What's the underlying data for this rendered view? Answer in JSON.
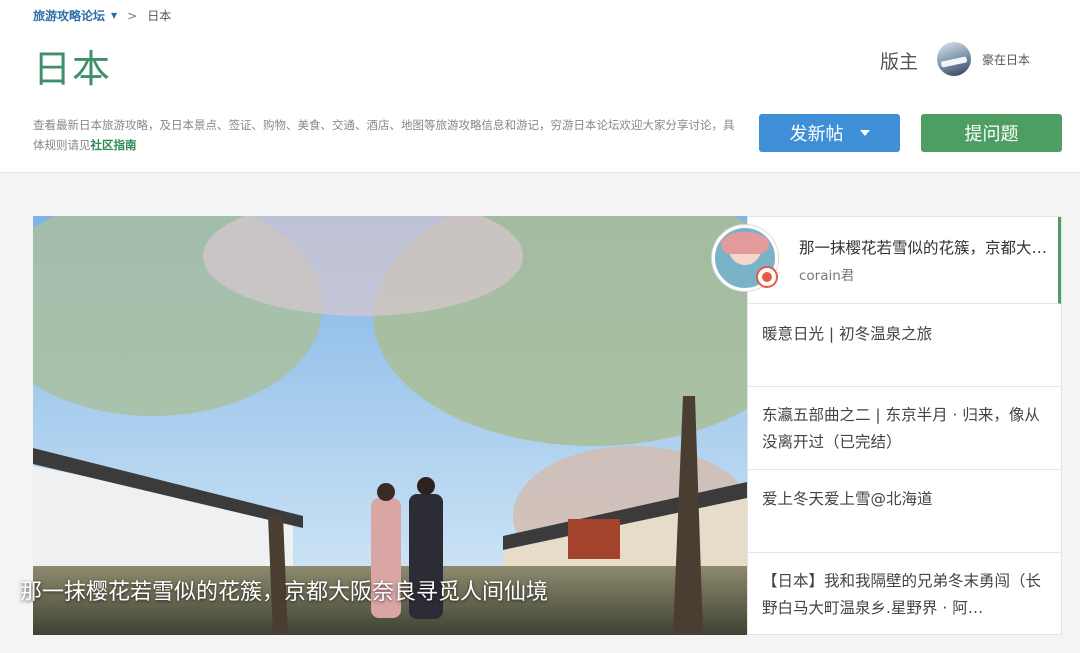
{
  "breadcrumb": {
    "forum": "旅游攻略论坛",
    "caret": "▼",
    "separator": ">",
    "current": "日本"
  },
  "page": {
    "title": "日本"
  },
  "moderator": {
    "label": "版主",
    "name": "豪在日本"
  },
  "description": {
    "text": "查看最新日本旅游攻略，及日本景点、签证、购物、美食、交通、酒店、地图等旅游攻略信息和游记，穷游日本论坛欢迎大家分享讨论，具体规则请见",
    "link": "社区指南"
  },
  "buttons": {
    "post": "发新帖",
    "ask": "提问题"
  },
  "featured": {
    "caption": "那一抹樱花若雪似的花簇，京都大阪奈良寻觅人间仙境"
  },
  "side_list": {
    "active": {
      "title": "那一抹樱花若雪似的花簇，京都大阪奈良寻觅人间仙境",
      "author": "corain君"
    },
    "items": [
      {
        "title": "暖意日光 | 初冬温泉之旅"
      },
      {
        "title": "东瀛五部曲之二 | 东京半月 · 归来，像从没离开过（已完结）"
      },
      {
        "title": "爱上冬天爱上雪@北海道"
      },
      {
        "title": "【日本】我和我隔壁的兄弟冬末勇闯（长野白马大町温泉乡.星野界 · 阿…"
      }
    ]
  },
  "colors": {
    "title_green": "#3f8f6a",
    "post_blue": "#3f8fd6",
    "ask_green": "#4e9d62",
    "link_green": "#2e8b57"
  }
}
